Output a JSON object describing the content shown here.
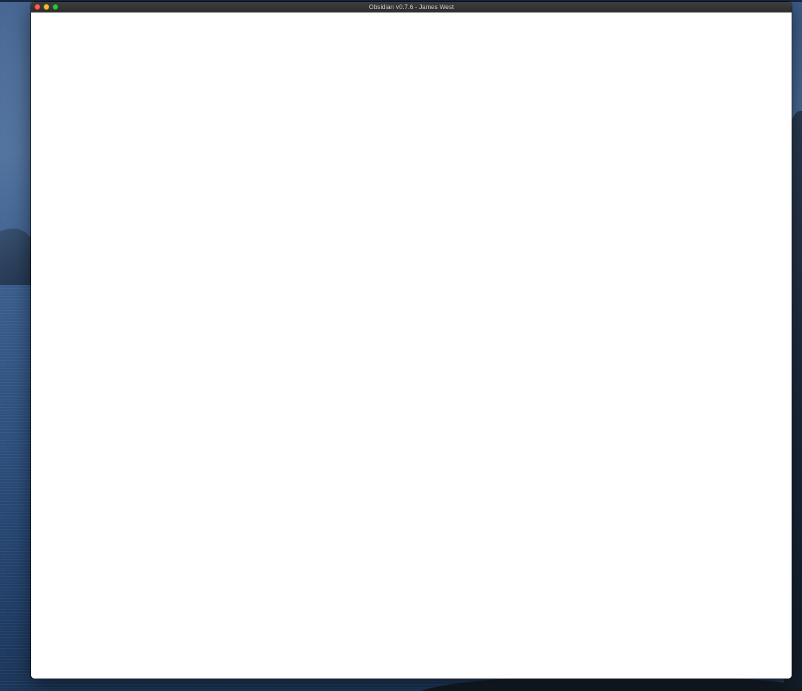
{
  "window": {
    "title": "Obsidian v0.7.6 - James West",
    "controls": [
      {
        "name": "close",
        "color": "#ff5f57"
      },
      {
        "name": "minimize",
        "color": "#febc2e"
      },
      {
        "name": "zoom",
        "color": "#28c840"
      }
    ],
    "content_background": "#ffffff",
    "titlebar_color": "#333333"
  },
  "desktop": {
    "wallpaper": "macOS Catalina island"
  }
}
